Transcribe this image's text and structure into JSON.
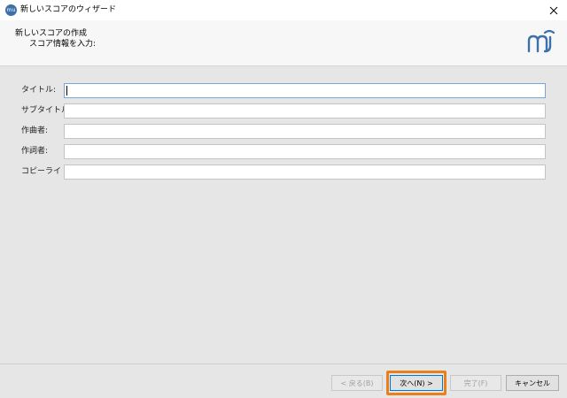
{
  "window": {
    "title": "新しいスコアのウィザード",
    "icon": "musescore-app-icon",
    "close_glyph": "✕"
  },
  "header": {
    "title": "新しいスコアの作成",
    "subtitle": "スコア情報を入力:",
    "logo": "musescore-logo-icon",
    "logo_color": "#3d6fa8"
  },
  "form": {
    "fields": [
      {
        "label": "タイトル:",
        "value": ""
      },
      {
        "label": "サブタイトル:",
        "value": ""
      },
      {
        "label": "作曲者:",
        "value": ""
      },
      {
        "label": "作詞者:",
        "value": ""
      },
      {
        "label": "コピーライト:",
        "value": ""
      }
    ]
  },
  "buttons": {
    "back": "< 戻る(B)",
    "next": "次へ(N) >",
    "finish": "完了(F)",
    "cancel": "キャンセル"
  },
  "colors": {
    "highlight": "#e8801e",
    "focus_border": "#7aa6d6",
    "dialog_background": "#e6e6e6"
  }
}
